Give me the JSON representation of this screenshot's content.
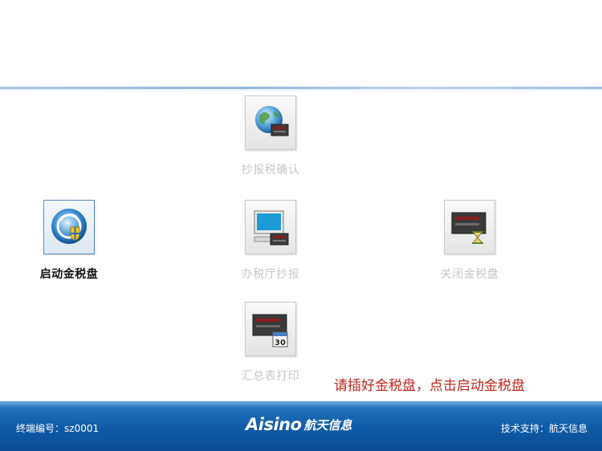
{
  "tiles": {
    "copy_confirm": {
      "label": "抄报税确认",
      "icon": "globe-icon",
      "enabled": false
    },
    "start_disk": {
      "label": "启动金税盘",
      "icon": "aisino-shield-icon",
      "enabled": true
    },
    "hall_report": {
      "label": "办税厅抄报",
      "icon": "monitor-icon",
      "enabled": false
    },
    "close_disk": {
      "label": "关闭金税盘",
      "icon": "hourglass-device-icon",
      "enabled": false
    },
    "summary_print": {
      "label": "汇总表打印",
      "icon": "calendar-device-icon",
      "enabled": false
    }
  },
  "notice": "请插好金税盘，点击启动金税盘",
  "footer": {
    "terminal_label": "终端编号：",
    "terminal_id": "sz0001",
    "brand_en": "Aisino",
    "brand_cn": "航天信息",
    "support": "技术支持：航天信息"
  },
  "colors": {
    "footer_blue": "#0f5aa6",
    "notice_red": "#c0271e",
    "disabled_text": "#c6c6c6",
    "active_border": "#5a8fc4"
  }
}
